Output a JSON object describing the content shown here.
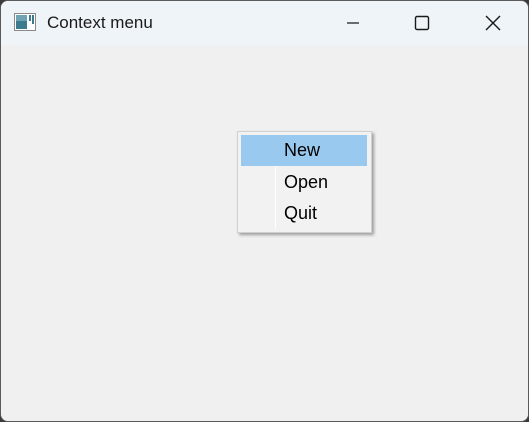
{
  "window": {
    "title": "Context menu",
    "icon": "app-window-icon",
    "controls": {
      "minimize_icon": "minimize-icon",
      "maximize_icon": "maximize-icon",
      "close_icon": "close-icon"
    }
  },
  "context_menu": {
    "items": [
      {
        "label": "New",
        "highlighted": true
      },
      {
        "label": "Open",
        "highlighted": false
      },
      {
        "label": "Quit",
        "highlighted": false
      }
    ]
  },
  "colors": {
    "titlebar": "#eff4f9",
    "client": "#f0f0f0",
    "menu_background": "#f2f2f2",
    "highlight": "#99c9ef"
  }
}
